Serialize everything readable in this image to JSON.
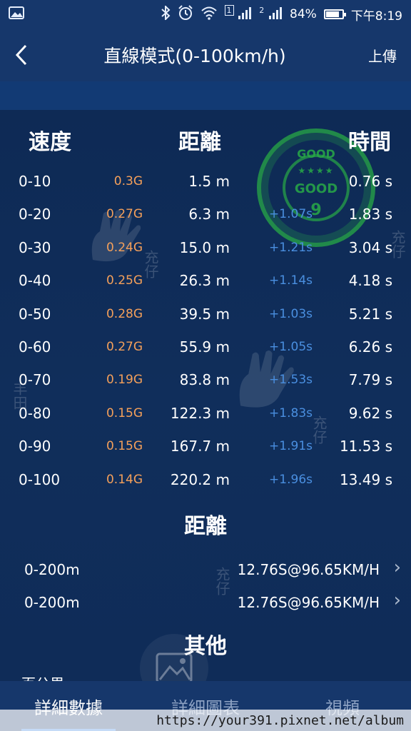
{
  "status_bar": {
    "battery": "84%",
    "battery_level": 0.84,
    "time": "下午8:19",
    "sim1_badge": "1",
    "sim2_badge": "2",
    "icons": [
      "image-icon",
      "bluetooth-icon",
      "alarm-icon",
      "wifi-icon",
      "signal-icon",
      "battery-icon"
    ]
  },
  "header": {
    "title": "直線模式(0-100km/h)",
    "upload": "上傳"
  },
  "table": {
    "headers": {
      "speed": "速度",
      "distance": "距離",
      "time": "時間"
    },
    "rows": [
      {
        "range": "0-10",
        "g": "0.3G",
        "distance": "1.5 m",
        "delta": "",
        "time": "0.76 s"
      },
      {
        "range": "0-20",
        "g": "0.27G",
        "distance": "6.3 m",
        "delta": "+1.07s",
        "time": "1.83 s"
      },
      {
        "range": "0-30",
        "g": "0.24G",
        "distance": "15.0 m",
        "delta": "+1.21s",
        "time": "3.04 s"
      },
      {
        "range": "0-40",
        "g": "0.25G",
        "distance": "26.3 m",
        "delta": "+1.14s",
        "time": "4.18 s"
      },
      {
        "range": "0-50",
        "g": "0.28G",
        "distance": "39.5 m",
        "delta": "+1.03s",
        "time": "5.21 s"
      },
      {
        "range": "0-60",
        "g": "0.27G",
        "distance": "55.9 m",
        "delta": "+1.05s",
        "time": "6.26 s"
      },
      {
        "range": "0-70",
        "g": "0.19G",
        "distance": "83.8 m",
        "delta": "+1.53s",
        "time": "7.79 s"
      },
      {
        "range": "0-80",
        "g": "0.15G",
        "distance": "122.3 m",
        "delta": "+1.83s",
        "time": "9.62 s"
      },
      {
        "range": "0-90",
        "g": "0.15G",
        "distance": "167.7 m",
        "delta": "+1.91s",
        "time": "11.53 s"
      },
      {
        "range": "0-100",
        "g": "0.14G",
        "distance": "220.2 m",
        "delta": "+1.96s",
        "time": "13.49 s"
      }
    ]
  },
  "distance_section": {
    "title": "距離",
    "items": [
      {
        "range": "0-200m",
        "value": "12.76S@96.65KM/H"
      },
      {
        "range": "0-200m",
        "value": "12.76S@96.65KM/H"
      }
    ]
  },
  "other_section": {
    "title": "其他",
    "partial_text": "百公里"
  },
  "stamp": {
    "top": "GOOD",
    "middle": "GOOD",
    "number": "9"
  },
  "watermark": {
    "text1": "充仔",
    "text2": "丰田"
  },
  "tabs": [
    {
      "label": "詳細數據",
      "active": true
    },
    {
      "label": "詳細圖表",
      "active": false
    },
    {
      "label": "視頻",
      "active": false
    }
  ],
  "url_overlay": "https://your391.pixnet.net/album"
}
